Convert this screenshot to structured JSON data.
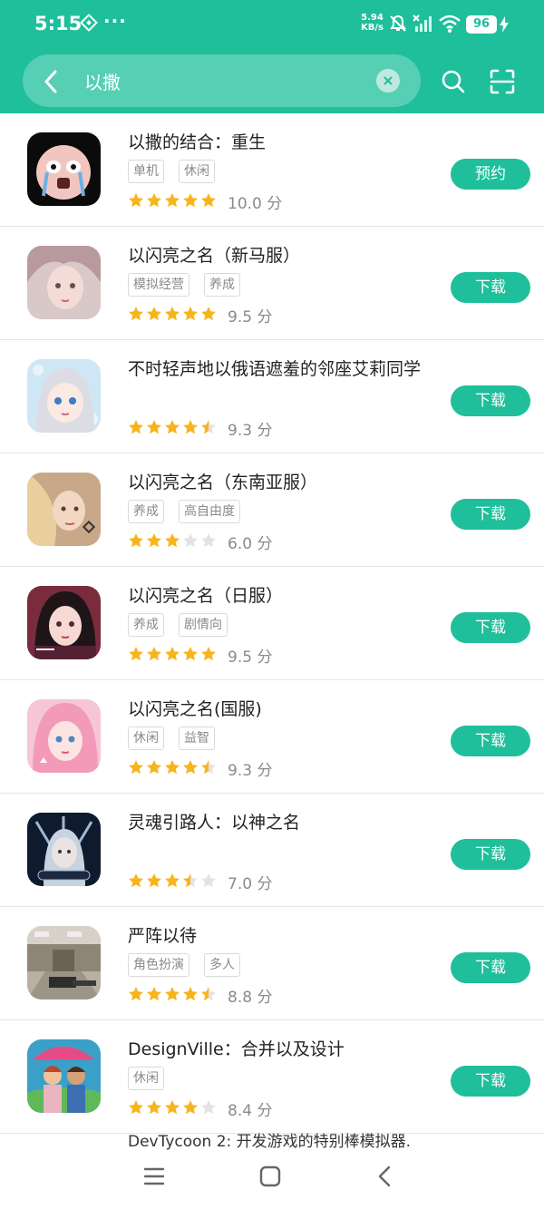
{
  "status": {
    "time": "5:15",
    "more": "···",
    "net_speed": "5.94",
    "net_unit": "KB/s",
    "battery": "96"
  },
  "search": {
    "query": "以撒"
  },
  "apps": [
    {
      "name": "以撒的结合：重生",
      "tags": [
        "单机",
        "休闲"
      ],
      "stars": 5,
      "score": "10.0 分",
      "action": "预约"
    },
    {
      "name": "以闪亮之名（新马服）",
      "tags": [
        "模拟经营",
        "养成"
      ],
      "stars": 5,
      "score": "9.5 分",
      "action": "下载"
    },
    {
      "name": "不时轻声地以俄语遮羞的邻座艾莉同学",
      "tags": [],
      "stars": 4.5,
      "score": "9.3 分",
      "action": "下载"
    },
    {
      "name": "以闪亮之名（东南亚服）",
      "tags": [
        "养成",
        "高自由度"
      ],
      "stars": 3,
      "score": "6.0 分",
      "action": "下载"
    },
    {
      "name": "以闪亮之名（日服）",
      "tags": [
        "养成",
        "剧情向"
      ],
      "stars": 5,
      "score": "9.5 分",
      "action": "下载"
    },
    {
      "name": "以闪亮之名(国服)",
      "tags": [
        "休闲",
        "益智"
      ],
      "stars": 4.5,
      "score": "9.3 分",
      "action": "下载"
    },
    {
      "name": "灵魂引路人：以神之名",
      "tags": [],
      "stars": 3.5,
      "score": "7.0 分",
      "action": "下载"
    },
    {
      "name": "严阵以待",
      "tags": [
        "角色扮演",
        "多人"
      ],
      "stars": 4.5,
      "score": "8.8 分",
      "action": "下载"
    },
    {
      "name": "DesignVille：合并以及设计",
      "tags": [
        "休闲"
      ],
      "stars": 4,
      "score": "8.4 分",
      "action": "下载"
    }
  ],
  "partial_app_name": "DevTycoon 2: 开发游戏的特别棒模拟器.",
  "colors": {
    "accent": "#1fbf9b",
    "star": "#f7b51c",
    "star_empty": "#e3e3e3"
  },
  "icons": {
    "back": "chevron-left-icon",
    "search": "search-icon",
    "scan": "scan-icon",
    "clear": "close-icon",
    "nav_menu": "menu-icon",
    "nav_home": "home-icon",
    "nav_back": "back-icon"
  }
}
